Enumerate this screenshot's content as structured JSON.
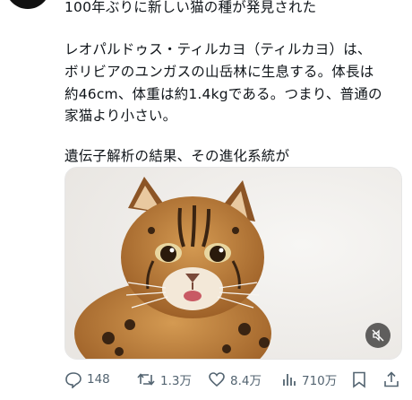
{
  "tweet": {
    "text_lines": [
      "100年ぶりに新しい猫の種が発見された",
      "レオパルドゥス・ティルカヨ（ティルカヨ）は、",
      "ボリビアのユンガスの山岳林に生息する。体長は",
      "約46cm、体重は約1.4kgである。つまり、普通の",
      "家猫より小さい。",
      "遺伝子解析の結果、その進化系統が"
    ],
    "media": {
      "icon": "mute-icon"
    }
  },
  "actions": {
    "replies": "148",
    "retweets": "1.3万",
    "likes": "8.4万",
    "views": "710万"
  }
}
